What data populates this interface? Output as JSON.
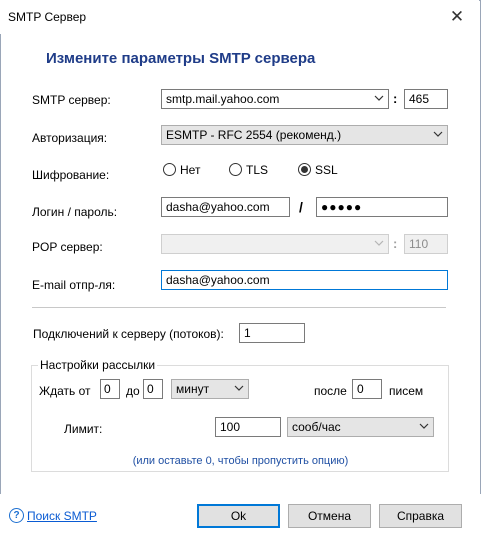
{
  "window": {
    "title": "SMTP Сервер",
    "close_glyph": "✕"
  },
  "heading": "Измените параметры SMTP сервера",
  "smtp": {
    "label": "SMTP сервер:",
    "value": "smtp.mail.yahoo.com",
    "separator": ":",
    "port": "465"
  },
  "auth": {
    "label": "Авторизация:",
    "value": "ESMTP - RFC 2554 (рекоменд.)"
  },
  "encryption": {
    "label": "Шифрование:",
    "options": [
      {
        "label": "Нет",
        "selected": false
      },
      {
        "label": "TLS",
        "selected": false
      },
      {
        "label": "SSL",
        "selected": true
      }
    ]
  },
  "login": {
    "label": "Логин / пароль:",
    "value": "dasha@yahoo.com",
    "separator": "/",
    "password": "●●●●●"
  },
  "pop": {
    "label": "POP сервер:",
    "value": "",
    "separator": ":",
    "port": "110"
  },
  "email": {
    "label": "E-mail отпр-ля:",
    "value": "dasha@yahoo.com"
  },
  "connections": {
    "label": "Подключений к серверу (потоков):",
    "value": "1"
  },
  "mailing": {
    "title": "Настройки рассылки",
    "wait_label": "Ждать от",
    "wait_from": "0",
    "to_label": "до",
    "wait_to": "0",
    "unit": "минут",
    "after_label": "после",
    "after_value": "0",
    "letters_label": "писем",
    "limit_label": "Лимит:",
    "limit_value": "100",
    "limit_unit": "сооб/час",
    "hint": "(или оставьте 0, чтобы пропустить опцию)"
  },
  "footer": {
    "help_icon": "?",
    "help_link": "Поиск SMTP",
    "ok": "Ok",
    "cancel": "Отмена",
    "help": "Справка"
  },
  "colors": {
    "heading": "#1f3c88",
    "focus": "#0078d7",
    "link": "#0a5bd3"
  },
  "icons": [
    "close-icon",
    "chevron-down-icon",
    "help-icon"
  ]
}
